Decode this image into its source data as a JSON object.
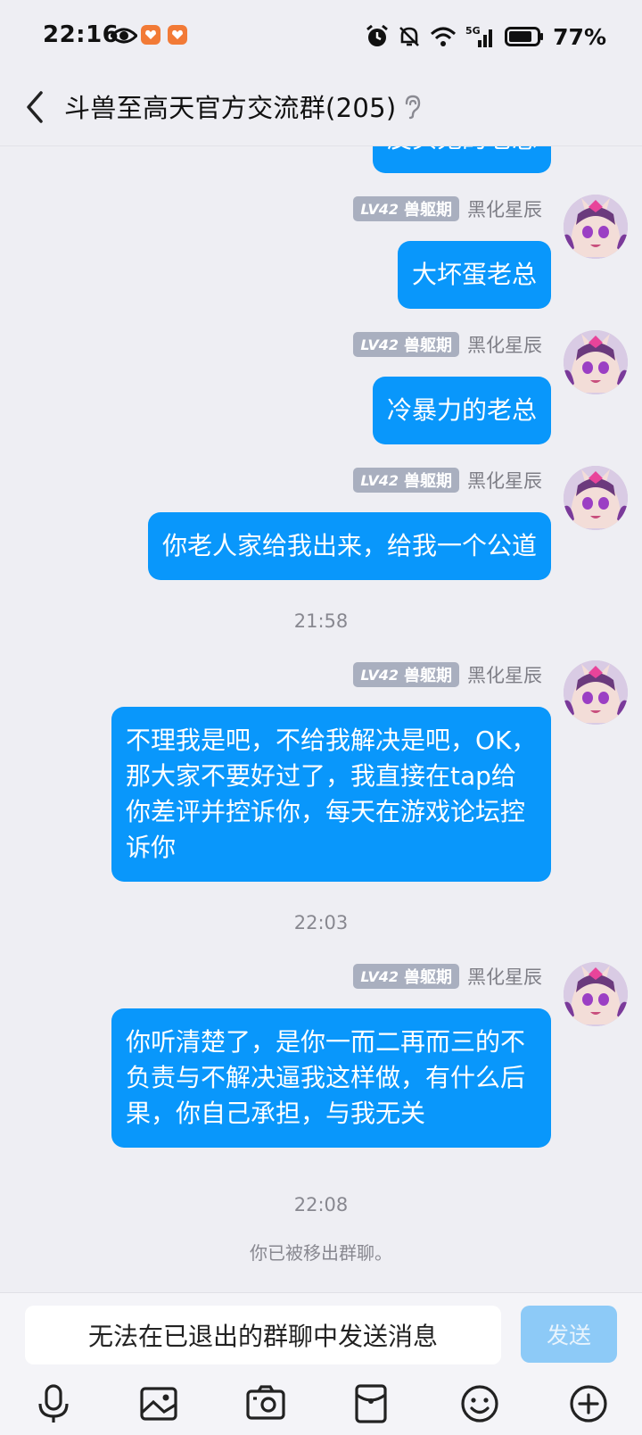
{
  "status_bar": {
    "time": "22:16",
    "network": "5G",
    "battery": "77%",
    "icons": [
      "eye-icon",
      "app-notification-icon",
      "alarm-icon",
      "mute-icon",
      "wifi-icon",
      "signal-icon",
      "battery-icon"
    ]
  },
  "header": {
    "title": "斗兽至高天官方交流群(205)",
    "icons": [
      "back-icon",
      "ear-icon"
    ]
  },
  "messages": [
    {
      "type": "message",
      "badge_level": "LV42",
      "badge_title": "兽躯期",
      "sender": "黑化星辰",
      "text": "皮头鬼的老总"
    },
    {
      "type": "message",
      "badge_level": "LV42",
      "badge_title": "兽躯期",
      "sender": "黑化星辰",
      "text": "大坏蛋老总"
    },
    {
      "type": "message",
      "badge_level": "LV42",
      "badge_title": "兽躯期",
      "sender": "黑化星辰",
      "text": "冷暴力的老总"
    },
    {
      "type": "message",
      "badge_level": "LV42",
      "badge_title": "兽躯期",
      "sender": "黑化星辰",
      "text": "你老人家给我出来，给我一个公道"
    },
    {
      "type": "time",
      "text": "21:58"
    },
    {
      "type": "message",
      "badge_level": "LV42",
      "badge_title": "兽躯期",
      "sender": "黑化星辰",
      "text": "不理我是吧，不给我解决是吧，OK，那大家不要好过了，我直接在tap给你差评并控诉你，每天在游戏论坛控诉你"
    },
    {
      "type": "time",
      "text": "22:03"
    },
    {
      "type": "message",
      "badge_level": "LV42",
      "badge_title": "兽躯期",
      "sender": "黑化星辰",
      "text": "你听清楚了，是你一而二再而三的不负责与不解决逼我这样做，有什么后果，你自己承担，与我无关"
    },
    {
      "type": "time",
      "text": "22:08"
    },
    {
      "type": "system",
      "text": "你已被移出群聊。"
    }
  ],
  "input": {
    "placeholder": "无法在已退出的群聊中发送消息",
    "send_label": "发送"
  },
  "toolbar": {
    "icons": [
      "microphone-icon",
      "image-icon",
      "camera-icon",
      "red-packet-icon",
      "emoji-icon",
      "plus-icon"
    ]
  },
  "colors": {
    "bubble": "#0997fb",
    "background": "#eeeef3",
    "badge": "#a9afbf",
    "send_disabled": "#8dcaf7"
  }
}
